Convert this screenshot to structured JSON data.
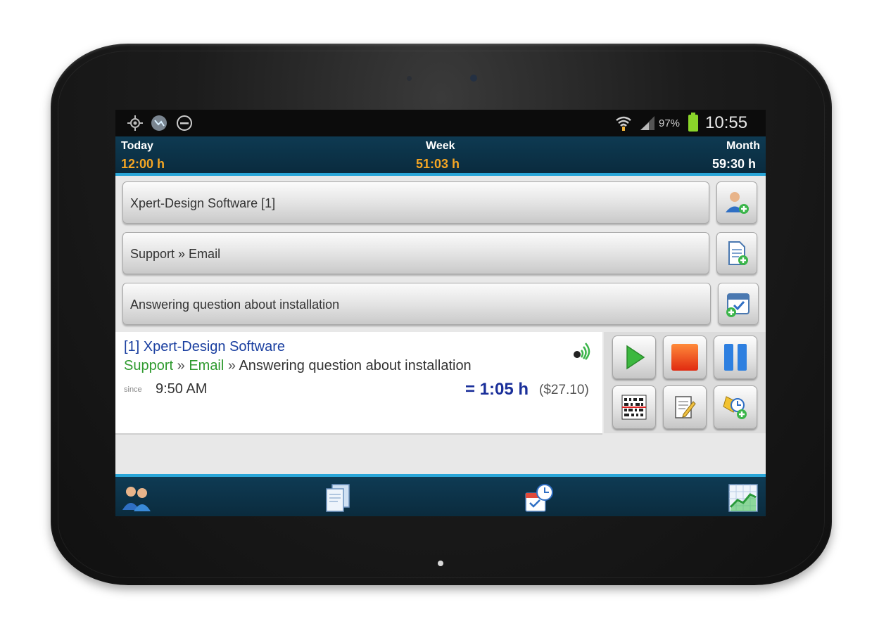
{
  "status_bar": {
    "battery_percent": "97%",
    "clock": "10:55",
    "left_icons": [
      "gps-icon",
      "sync-icon",
      "do-not-disturb-icon"
    ],
    "right_icons": [
      "wifi-icon",
      "signal-icon",
      "battery-icon"
    ]
  },
  "summary": {
    "today_label": "Today",
    "today_value": "12:00 h",
    "week_label": "Week",
    "week_value": "51:03 h",
    "month_label": "Month",
    "month_value": "59:30 h"
  },
  "selectors": {
    "client": "Xpert-Design Software [1]",
    "task": "Support » Email",
    "description": "Answering question about installation"
  },
  "entry": {
    "client": "[1] Xpert-Design Software",
    "category": "Support",
    "sep1": " » ",
    "task": "Email",
    "sep2": " » ",
    "description": "Answering question about installation",
    "since_label": "since",
    "since_time": "9:50 AM",
    "duration": "= 1:05 h",
    "cost": "($27.10)"
  },
  "colors": {
    "accent": "#2aa6d8",
    "header_bg": "#0e3a52",
    "highlight": "#f5a623",
    "client_link": "#1a3fa0",
    "category_green": "#2e9a2e"
  },
  "bottom_nav": [
    "clients-icon",
    "documents-icon",
    "calendar-clock-icon",
    "statistics-chart-icon"
  ]
}
